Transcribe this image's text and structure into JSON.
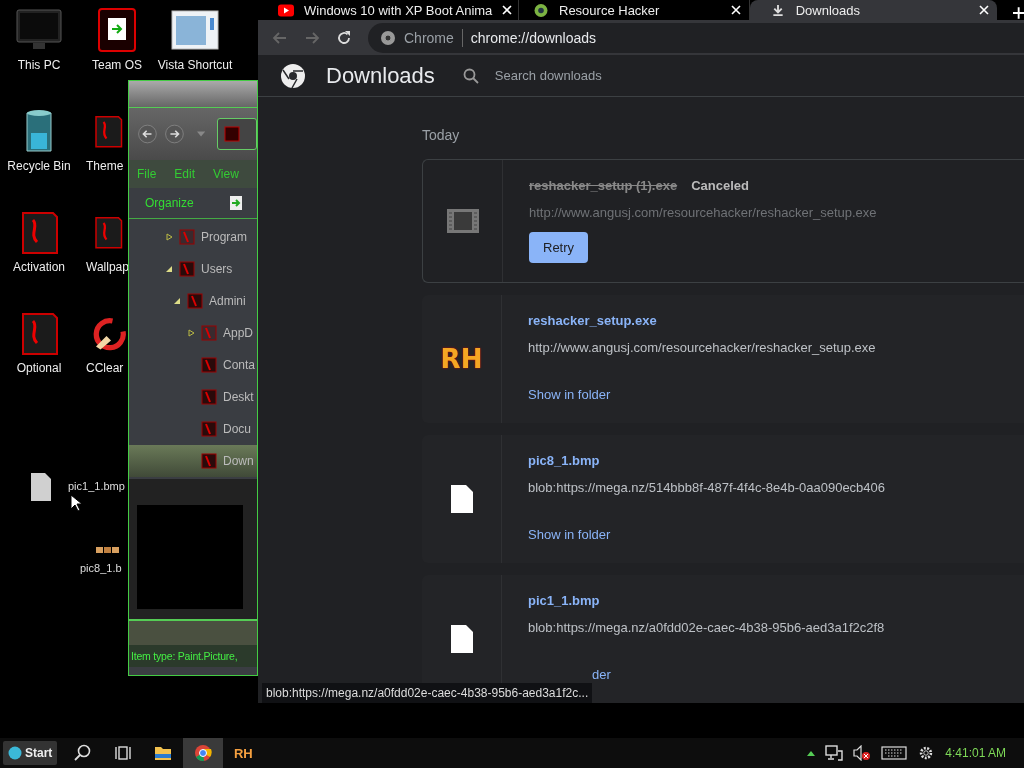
{
  "desktop_icons": [
    {
      "label": "This PC",
      "kind": "monitor"
    },
    {
      "label": "Team OS",
      "kind": "redbox"
    },
    {
      "label": "Vista Shortcut",
      "kind": "shortcut"
    },
    {
      "label": "Recycle Bin",
      "kind": "bin"
    },
    {
      "label": "Theme",
      "kind": "dragon"
    },
    {
      "label": "Activation",
      "kind": "dragon"
    },
    {
      "label": "Wallpap",
      "kind": "dragon"
    },
    {
      "label": "Optional",
      "kind": "dragon"
    },
    {
      "label": "CClear",
      "kind": "cleaner"
    }
  ],
  "desktop_files": [
    {
      "label": "pic1_1.bmp",
      "kind": "blank"
    },
    {
      "label": "pic8_1.b",
      "kind": "strip"
    }
  ],
  "explorer": {
    "menu": [
      "File",
      "Edit",
      "View"
    ],
    "organize": "Organize",
    "tree": [
      {
        "label": "Program",
        "expanded": false,
        "selected": false
      },
      {
        "label": "Users",
        "expanded": true,
        "selected": false,
        "children": [
          {
            "label": "Admini",
            "expanded": true,
            "selected": false,
            "children": [
              {
                "label": "AppD",
                "expanded": false,
                "selected": false
              },
              {
                "label": "Conta",
                "selected": false
              },
              {
                "label": "Deskt",
                "selected": false
              },
              {
                "label": "Docu",
                "selected": false
              },
              {
                "label": "Down",
                "selected": true
              }
            ]
          }
        ]
      }
    ],
    "status": "Item type: Paint.Picture,"
  },
  "browser": {
    "tabs": [
      {
        "title": "Windows 10 with XP Boot Anima",
        "kind": "video",
        "selected": false
      },
      {
        "title": "Resource Hacker",
        "kind": "site",
        "selected": false
      },
      {
        "title": "Downloads",
        "kind": "download",
        "selected": true
      }
    ],
    "omnibox": {
      "origin": "Chrome",
      "url": "chrome://downloads"
    },
    "page_title": "Downloads",
    "search": {
      "placeholder": "Search downloads"
    },
    "section": "Today",
    "downloads": [
      {
        "kind": "canceled",
        "name": "reshacker_setup (1).exe",
        "status": "Canceled",
        "url": "http://www.angusj.com/resourcehacker/reshacker_setup.exe",
        "button": "Retry"
      },
      {
        "kind": "app",
        "icon_text": "RH",
        "name": "reshacker_setup.exe",
        "url": "http://www.angusj.com/resourcehacker/reshacker_setup.exe",
        "link": "Show in folder"
      },
      {
        "kind": "file",
        "name": "pic8_1.bmp",
        "url": "blob:https://mega.nz/514bbb8f-487f-4f4c-8e4b-0aa090ecb406",
        "link": "Show in folder"
      },
      {
        "kind": "file",
        "name": "pic1_1.bmp",
        "url": "blob:https://mega.nz/a0fdd02e-caec-4b38-95b6-aed3a1f2c2f8",
        "link": "der"
      }
    ],
    "status_bubble": "blob:https://mega.nz/a0fdd02e-caec-4b38-95b6-aed3a1f2c..."
  },
  "taskbar": {
    "start": "Start",
    "apps": [
      {
        "kind": "search",
        "active": false
      },
      {
        "kind": "taskview",
        "active": false
      },
      {
        "kind": "explorer",
        "active": false
      },
      {
        "kind": "chrome",
        "active": true
      },
      {
        "kind": "text",
        "text": "RH",
        "active": false
      }
    ],
    "clock": "4:41:01 AM"
  }
}
